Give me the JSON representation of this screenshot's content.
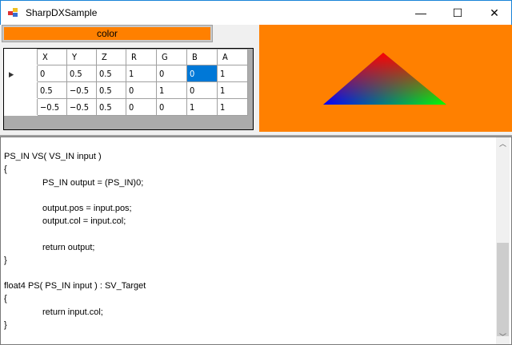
{
  "window": {
    "title": "SharpDXSample",
    "minimize": "—",
    "maximize": "☐",
    "close": "✕"
  },
  "color_button": {
    "label": "color",
    "color": "#ff8000"
  },
  "grid": {
    "columns": [
      "X",
      "Y",
      "Z",
      "R",
      "G",
      "B",
      "A"
    ],
    "rows": [
      [
        "0",
        "0.5",
        "0.5",
        "1",
        "0",
        "0",
        "1"
      ],
      [
        "0.5",
        "−0.5",
        "0.5",
        "0",
        "1",
        "0",
        "1"
      ],
      [
        "−0.5",
        "−0.5",
        "0.5",
        "0",
        "0",
        "1",
        "1"
      ]
    ],
    "current_row_marker": "▶"
  },
  "code": {
    "lines": [
      "",
      "PS_IN VS( VS_IN input )",
      "{",
      "PS_IN output = (PS_IN)0;",
      "",
      "output.pos = input.pos;",
      "output.col = input.col;",
      "",
      "return output;",
      "}",
      "",
      "float4 PS( PS_IN input ) : SV_Target",
      "{",
      "return input.col;",
      "}"
    ],
    "indented": [
      3,
      5,
      6,
      8,
      13
    ]
  },
  "scrollbar": {
    "up": "︿",
    "down": "﹀"
  }
}
